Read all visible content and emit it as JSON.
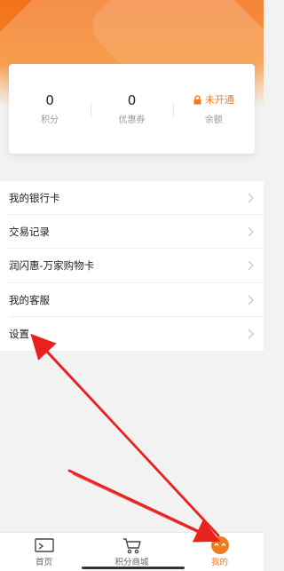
{
  "stats": [
    {
      "value": "0",
      "label": "积分"
    },
    {
      "value": "0",
      "label": "优惠券"
    },
    {
      "value": "未开通",
      "label": "余额",
      "locked": true
    }
  ],
  "menu": [
    {
      "label": "我的银行卡"
    },
    {
      "label": "交易记录"
    },
    {
      "label": "润闪惠-万家购物卡"
    },
    {
      "label": "我的客服"
    },
    {
      "label": "设置"
    }
  ],
  "tabs": [
    {
      "label": "首页",
      "icon": "home-icon",
      "active": false
    },
    {
      "label": "积分商城",
      "icon": "cart-icon",
      "active": false
    },
    {
      "label": "我的",
      "icon": "profile-smile-icon",
      "active": true
    }
  ],
  "colors": {
    "accent": "#f07b1c",
    "header_gradient_top": "#f2711b",
    "header_gradient_bottom": "#f6a24a",
    "annotation_arrow": "#e8231f"
  }
}
